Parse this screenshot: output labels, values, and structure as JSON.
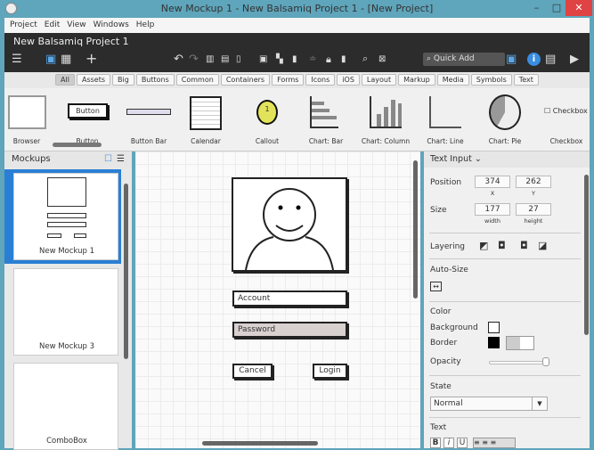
{
  "window": {
    "title": "New Mockup 1 - New Balsamiq Project 1 - [New Project]",
    "minimize": "–",
    "maximize": "□",
    "close": "✕"
  },
  "menu": [
    "Project",
    "Edit",
    "View",
    "Windows",
    "Help"
  ],
  "project_title": "New Balsamiq Project 1",
  "toolbar": {
    "quick_add_placeholder": "Quick Add"
  },
  "filters": [
    "All",
    "Assets",
    "Big",
    "Buttons",
    "Common",
    "Containers",
    "Forms",
    "Icons",
    "iOS",
    "Layout",
    "Markup",
    "Media",
    "Symbols",
    "Text"
  ],
  "active_filter": "All",
  "library": [
    "Browser",
    "Button",
    "Button Bar",
    "Calendar",
    "Callout",
    "Chart: Bar",
    "Chart: Column",
    "Chart: Line",
    "Chart: Pie",
    "Checkbox"
  ],
  "library_preview": {
    "button": "Button",
    "callout": "1",
    "checkbox": "Checkbox"
  },
  "mockups": {
    "title": "Mockups",
    "items": [
      "New Mockup 1",
      "New Mockup 3",
      "ComboBox"
    ],
    "selected": "New Mockup 1"
  },
  "canvas": {
    "account": "Account",
    "password": "Password",
    "cancel": "Cancel",
    "login": "Login"
  },
  "inspector": {
    "title": "Text Input",
    "position_label": "Position",
    "x": "374",
    "y": "262",
    "x_label": "X",
    "y_label": "Y",
    "size_label": "Size",
    "width": "177",
    "height": "27",
    "width_label": "width",
    "height_label": "height",
    "layering_label": "Layering",
    "autosize_label": "Auto-Size",
    "color_label": "Color",
    "background_label": "Background",
    "border_label": "Border",
    "opacity_label": "Opacity",
    "opacity": 100,
    "state_label": "State",
    "state_value": "Normal",
    "text_label": "Text",
    "bold": "B",
    "italic": "i",
    "underline": "U"
  },
  "colors": {
    "accent": "#2a7fd4",
    "titlebar": "#5fa5bb",
    "dark_toolbar": "#2c2c2c",
    "close": "#e04343",
    "password_fill": "#d9d0d0"
  }
}
